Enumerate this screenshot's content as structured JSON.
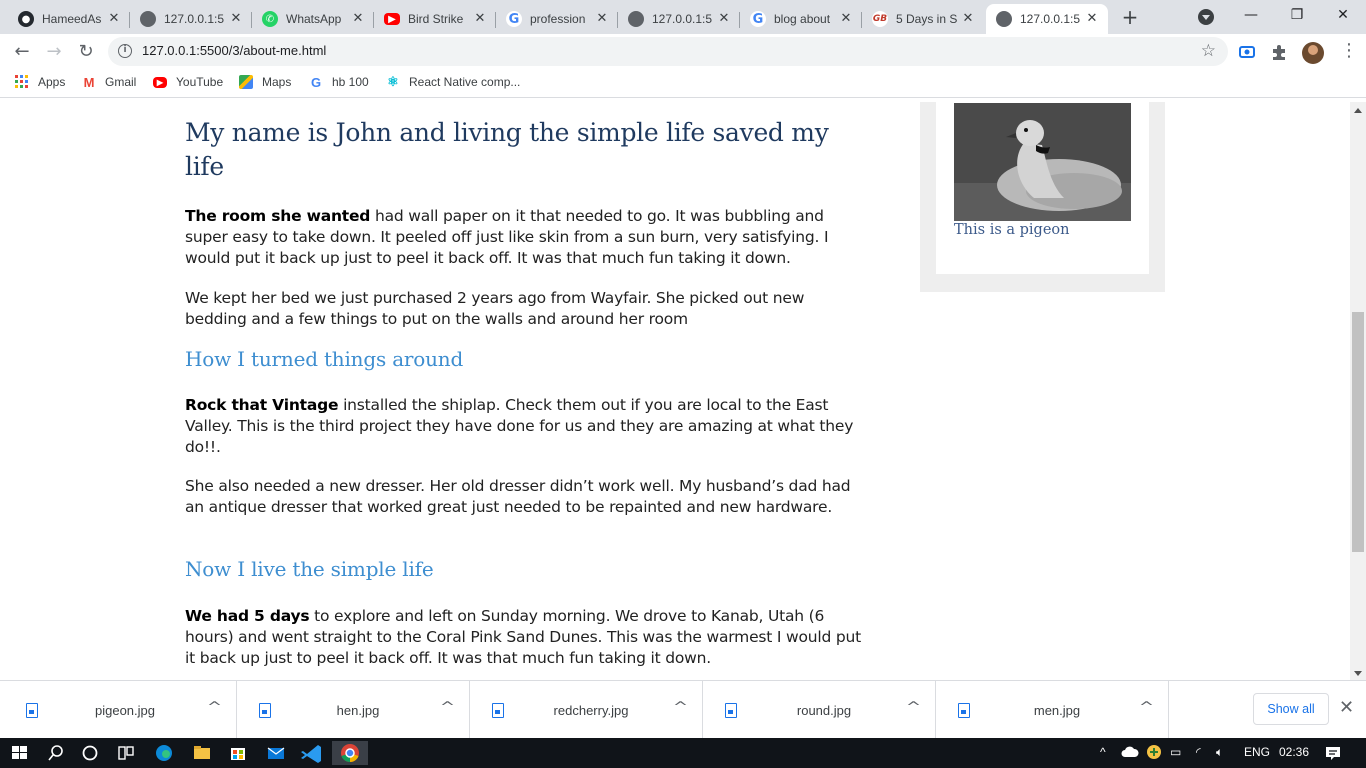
{
  "browser": {
    "tabs": [
      {
        "title": "HameedAs",
        "favicon": "github-icon",
        "color": "#24292f"
      },
      {
        "title": "127.0.0.1:5",
        "favicon": "globe-icon",
        "color": "#5f6368"
      },
      {
        "title": "WhatsApp",
        "favicon": "whatsapp-icon",
        "color": "#25d366"
      },
      {
        "title": "Bird Strike",
        "favicon": "youtube-icon",
        "color": "#ff0000"
      },
      {
        "title": "profession",
        "favicon": "google-icon",
        "color": "#4285f4"
      },
      {
        "title": "127.0.0.1:5",
        "favicon": "globe-icon",
        "color": "#5f6368"
      },
      {
        "title": "blog about",
        "favicon": "google-icon",
        "color": "#4285f4"
      },
      {
        "title": "5 Days in S",
        "favicon": "blog-logo-icon",
        "color": "#c0392b"
      },
      {
        "title": "127.0.0.1:5",
        "favicon": "globe-icon",
        "color": "#5f6368",
        "active": true
      }
    ],
    "address": "127.0.0.1:5500/3/about-me.html",
    "bookmarks": [
      {
        "label": "Apps",
        "icon": "apps-grid-icon"
      },
      {
        "label": "Gmail",
        "icon": "gmail-icon"
      },
      {
        "label": "YouTube",
        "icon": "youtube-icon"
      },
      {
        "label": "Maps",
        "icon": "maps-icon"
      },
      {
        "label": "hb 100",
        "icon": "google-icon"
      },
      {
        "label": "React Native comp...",
        "icon": "react-icon"
      }
    ]
  },
  "article": {
    "title": "My name is John and living the simple life saved my life",
    "p1_bold": "The room she wanted",
    "p1_text": " had wall paper on it that needed to go. It was bubbling and super easy to take down. It peeled off just like skin from a sun burn, very satisfying. I would put it back up just to peel it back off. It was that much fun taking it down.",
    "p2_text": "We kept her bed we just purchased 2 years ago from Wayfair. She picked out new bedding and a few things to put on the walls and around her room",
    "h2_1": "How I turned things around",
    "p3_bold": "Rock that Vintage",
    "p3_text": " installed the shiplap. Check them out if you are local to the East Valley. This is the third project they have done for us and they are amazing at what they do!!.",
    "p4_text": "She also needed a new dresser. Her old dresser didn’t work well. My husband’s dad had an antique dresser that worked great just needed to be repainted and new hardware.",
    "h2_2": "Now I live the simple life",
    "p5_bold": "We had 5 days",
    "p5_text": " to explore and left on Sunday morning. We drove to Kanab, Utah (6 hours) and went straight to the Coral Pink Sand Dunes. This was the warmest I would put it back up just to peel it back off. It was that much fun taking it down."
  },
  "sidebar": {
    "caption": "This is a pigeon"
  },
  "downloads": {
    "files": [
      "pigeon.jpg",
      "hen.jpg",
      "redcherry.jpg",
      "round.jpg",
      "men.jpg"
    ],
    "show_all": "Show all"
  },
  "taskbar": {
    "language": "ENG",
    "time": "02:36"
  }
}
